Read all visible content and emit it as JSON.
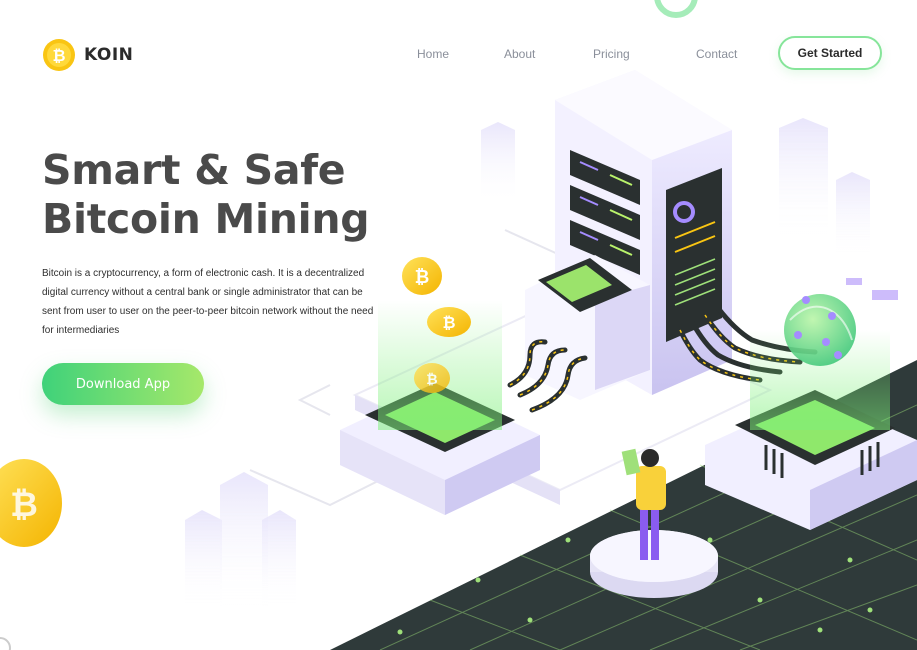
{
  "brand": {
    "name": "KOIN",
    "coin_color": "#f9c513"
  },
  "nav": {
    "items": [
      {
        "label": "Home"
      },
      {
        "label": "About"
      },
      {
        "label": "Pricing"
      },
      {
        "label": "Contact"
      }
    ],
    "cta_label": "Get Started"
  },
  "hero": {
    "title_line1": "Smart & Safe",
    "title_line2": "Bitcoin Mining",
    "description": "Bitcoin is a cryptocurrency, a form of electronic cash. It is a decentralized digital currency without a central bank or single administrator that can be sent from user to user on the peer-to-peer bitcoin network without the need for intermediaries",
    "download_label": "Download App"
  },
  "colors": {
    "accent_green": "#3fd27a",
    "accent_lime": "#a6e86a",
    "coin_yellow": "#f9c513",
    "lavender": "#cfcaf2",
    "grid_dark": "#2f3a3a"
  },
  "icons": [
    "bitcoin-coin-icon",
    "server-tower-icon",
    "globe-icon",
    "person-icon"
  ]
}
